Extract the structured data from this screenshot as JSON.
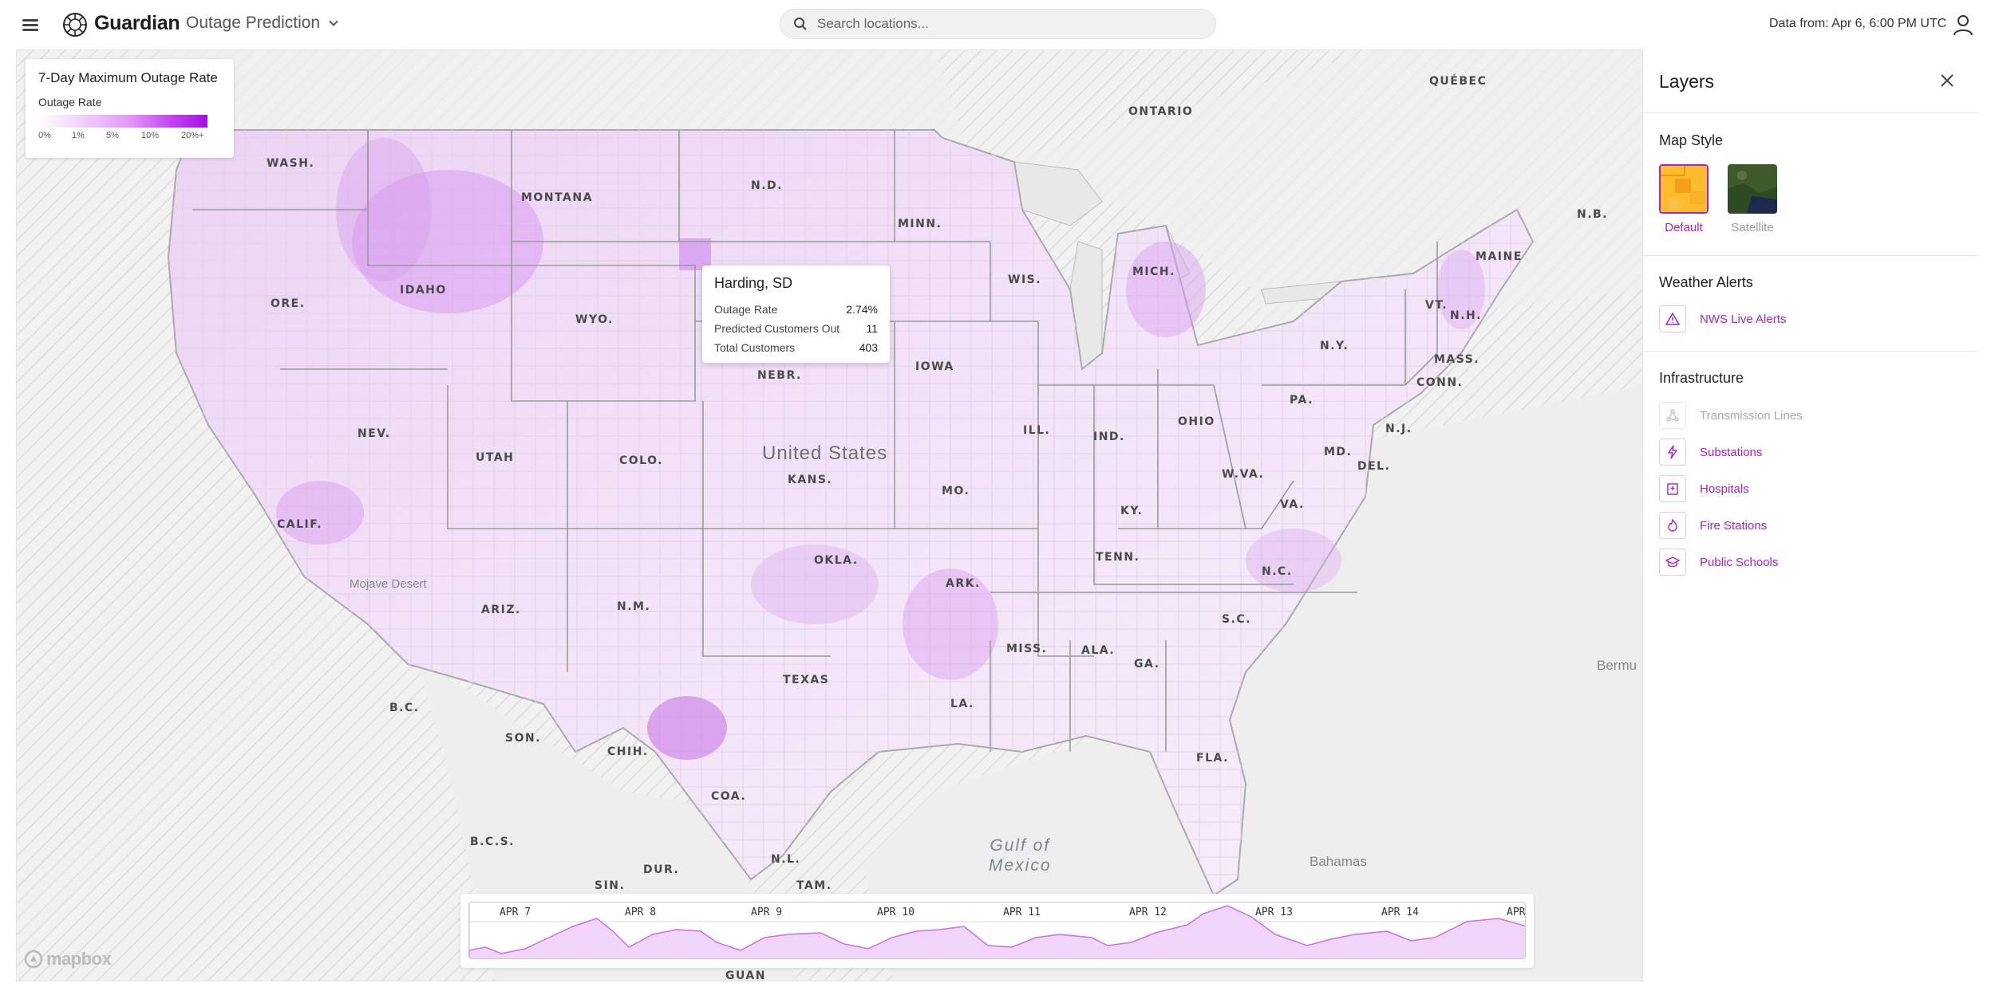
{
  "header": {
    "brand": "Guardian",
    "mode_label": "Outage Prediction",
    "search_placeholder": "Search locations...",
    "data_from": "Data from: Apr 6, 6:00 PM UTC"
  },
  "legend": {
    "title": "7-Day Maximum Outage Rate",
    "subtitle": "Outage Rate",
    "ticks": [
      "0%",
      "1%",
      "5%",
      "10%",
      "20%+"
    ],
    "colors": [
      "#ffffff",
      "#f2d3fb",
      "#e294f8",
      "#c23ff0",
      "#a50ee6"
    ]
  },
  "tooltip": {
    "title": "Harding, SD",
    "rows": [
      {
        "label": "Outage Rate",
        "value": "2.74%"
      },
      {
        "label": "Predicted Customers Out",
        "value": "11"
      },
      {
        "label": "Total Customers",
        "value": "403"
      }
    ]
  },
  "map": {
    "country": "United States",
    "gulf": [
      "Gulf of",
      "Mexico"
    ],
    "desert": "Mojave Desert",
    "bahamas": "Bahamas",
    "bermuda": "Bermu",
    "attribution": "mapbox",
    "labels": {
      "wash": "WASH.",
      "ore": "ORE.",
      "calif": "CALIF.",
      "idaho": "IDAHO",
      "nev": "NEV.",
      "montana": "MONTANA",
      "wyo": "WYO.",
      "utah": "UTAH",
      "ariz": "ARIZ.",
      "colo": "COLO.",
      "nm": "N.M.",
      "nd": "N.D.",
      "nebr": "NEBR.",
      "kans": "KANS.",
      "okla": "OKLA.",
      "texas": "TEXAS",
      "minn": "MINN.",
      "iowa": "IOWA",
      "mo": "MO.",
      "ark": "ARK.",
      "la": "LA.",
      "wis": "WIS.",
      "ill": "ILL.",
      "mich": "MICH.",
      "ind": "IND.",
      "ohio": "OHIO",
      "ky": "KY.",
      "tenn": "TENN.",
      "miss": "MISS.",
      "ala": "ALA.",
      "ga": "GA.",
      "fla": "FLA.",
      "sc": "S.C.",
      "nc": "N.C.",
      "va": "VA.",
      "wva": "W.VA.",
      "pa": "PA.",
      "ny": "N.Y.",
      "md": "MD.",
      "del": "DEL.",
      "nj": "N.J.",
      "conn": "CONN.",
      "mass": "MASS.",
      "vt": "VT.",
      "nh": "N.H.",
      "maine": "MAINE",
      "ontario": "ONTARIO",
      "quebec": "QUÉBEC",
      "nb": "N.B.",
      "bc": "B.C.",
      "son": "SON.",
      "chih": "CHIH.",
      "coa": "COA.",
      "nl": "N.L.",
      "dur": "DUR.",
      "sin": "SIN.",
      "tam": "TAM.",
      "bcs": "B.C.S.",
      "guan": "GUAN"
    }
  },
  "timeline": {
    "labels": [
      "APR 7",
      "APR 8",
      "APR 9",
      "APR 10",
      "APR 11",
      "APR 12",
      "APR 13",
      "APR 14",
      "APR"
    ]
  },
  "panel": {
    "title": "Layers",
    "map_style_title": "Map Style",
    "styles": [
      {
        "label": "Default",
        "selected": true
      },
      {
        "label": "Satellite",
        "selected": false
      }
    ],
    "weather_title": "Weather Alerts",
    "weather_layers": [
      {
        "label": "NWS Live Alerts",
        "icon": "warning-icon"
      }
    ],
    "infra_title": "Infrastructure",
    "infra_layers": [
      {
        "label": "Transmission Lines",
        "icon": "transmission-icon",
        "disabled": true
      },
      {
        "label": "Substations",
        "icon": "bolt-icon",
        "disabled": false
      },
      {
        "label": "Hospitals",
        "icon": "hospital-icon",
        "disabled": false
      },
      {
        "label": "Fire Stations",
        "icon": "flame-icon",
        "disabled": false
      },
      {
        "label": "Public Schools",
        "icon": "school-icon",
        "disabled": false
      }
    ],
    "accent": "#a623cf"
  }
}
